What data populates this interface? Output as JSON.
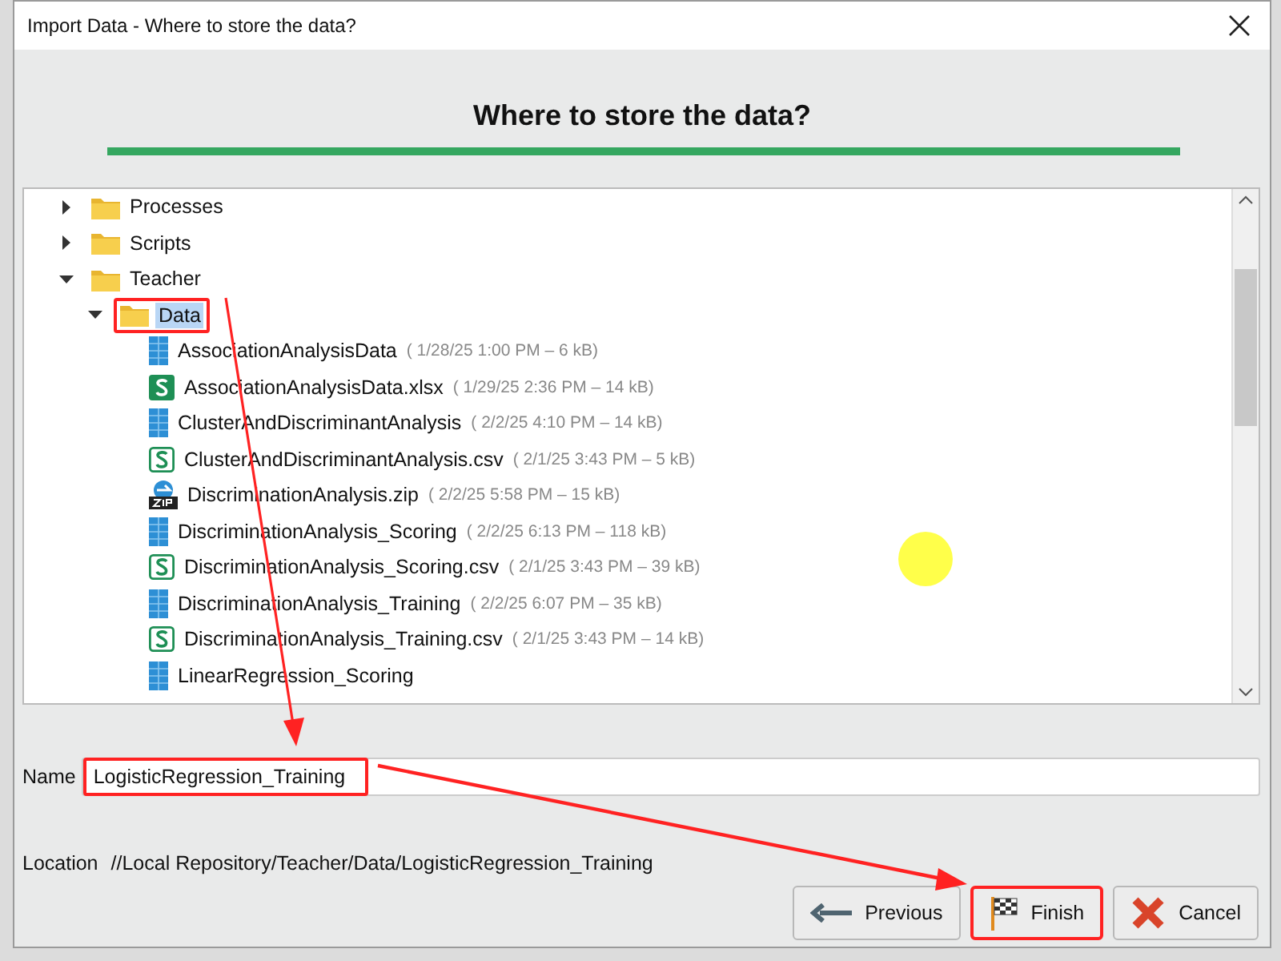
{
  "window": {
    "title": "Import Data - Where to store the data?"
  },
  "header": {
    "title": "Where to store the data?"
  },
  "tree": [
    {
      "label": "Processes",
      "kind": "folder",
      "expanded": false,
      "selected": false,
      "highlighted": false
    },
    {
      "label": "Scripts",
      "kind": "folder",
      "expanded": false,
      "selected": false,
      "highlighted": false
    },
    {
      "label": "Teacher",
      "kind": "folder",
      "expanded": true,
      "selected": false,
      "highlighted": false,
      "children": [
        {
          "label": "Data",
          "kind": "folder",
          "expanded": true,
          "selected": true,
          "highlighted": true,
          "children": [
            {
              "label": "AssociationAnalysisData",
              "meta": "( 1/28/25 1:00 PM – 6 kB)",
              "kind": "data",
              "selected": false,
              "highlighted": false
            },
            {
              "label": "AssociationAnalysisData.xlsx",
              "meta": "( 1/29/25 2:36 PM – 14 kB)",
              "kind": "xlsx",
              "selected": false,
              "highlighted": false
            },
            {
              "label": "ClusterAndDiscriminantAnalysis",
              "meta": "( 2/2/25 4:10 PM – 14 kB)",
              "kind": "data",
              "selected": false,
              "highlighted": false
            },
            {
              "label": "ClusterAndDiscriminantAnalysis.csv",
              "meta": "( 2/1/25 3:43 PM – 5 kB)",
              "kind": "csv",
              "selected": false,
              "highlighted": false
            },
            {
              "label": "DiscriminationAnalysis.zip",
              "meta": "( 2/2/25 5:58 PM – 15 kB)",
              "kind": "zip",
              "selected": false,
              "highlighted": false
            },
            {
              "label": "DiscriminationAnalysis_Scoring",
              "meta": "( 2/2/25 6:13 PM – 118 kB)",
              "kind": "data",
              "selected": false,
              "highlighted": false
            },
            {
              "label": "DiscriminationAnalysis_Scoring.csv",
              "meta": "( 2/1/25 3:43 PM – 39 kB)",
              "kind": "csv",
              "selected": false,
              "highlighted": false
            },
            {
              "label": "DiscriminationAnalysis_Training",
              "meta": "( 2/2/25 6:07 PM – 35 kB)",
              "kind": "data",
              "selected": false,
              "highlighted": false
            },
            {
              "label": "DiscriminationAnalysis_Training.csv",
              "meta": "( 2/1/25 3:43 PM – 14 kB)",
              "kind": "csv",
              "selected": false,
              "highlighted": false
            },
            {
              "label": "LinearRegression_Scoring",
              "kind": "data",
              "selected": false,
              "highlighted": false
            }
          ]
        }
      ]
    }
  ],
  "name_field": {
    "label": "Name",
    "value": "LogisticRegression_Training",
    "highlighted": true
  },
  "location": {
    "label": "Location",
    "value": "//Local Repository/Teacher/Data/LogisticRegression_Training"
  },
  "buttons": [
    {
      "label": "Previous",
      "kind": "previous",
      "highlighted": false
    },
    {
      "label": "Finish",
      "kind": "finish",
      "highlighted": true
    },
    {
      "label": "Cancel",
      "kind": "cancel",
      "highlighted": false
    }
  ]
}
